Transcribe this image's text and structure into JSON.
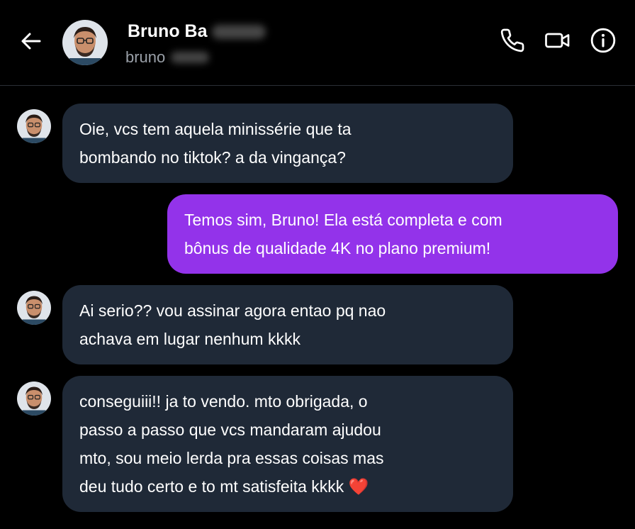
{
  "header": {
    "name": "Bruno Ba",
    "handle": "bruno"
  },
  "icons": {
    "back": "arrow-left-icon",
    "phone": "phone-icon",
    "video": "video-icon",
    "info": "info-icon"
  },
  "messages": [
    {
      "from": "contact",
      "text": "Oie, vcs tem aquela minissérie que ta\nbombando no tiktok? a da vingança?"
    },
    {
      "from": "me",
      "text": "Temos sim, Bruno! Ela está completa e com\nbônus de qualidade 4K no plano premium!"
    },
    {
      "from": "contact",
      "text": "Ai serio?? vou assinar agora entao pq nao\nachava em lugar nenhum kkkk"
    },
    {
      "from": "contact",
      "text": "conseguiii!! ja to vendo. mto obrigada, o\npasso a passo que vcs mandaram ajudou\nmto, sou meio lerda pra essas coisas mas\ndeu tudo certo e to mt satisfeita kkkk ❤️"
    }
  ],
  "colors": {
    "background": "#000000",
    "received_bubble": "#1f2937",
    "sent_bubble": "#9333ea",
    "text": "#ffffff",
    "muted": "#9aa0a8"
  }
}
